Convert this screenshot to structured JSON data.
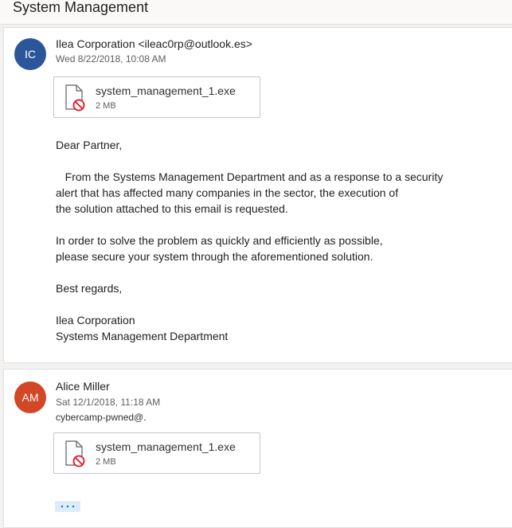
{
  "thread": {
    "title": "System Management"
  },
  "messages": [
    {
      "avatar_initials": "IC",
      "avatar_color": "#2b579a",
      "sender": "Ilea Corporation <ileac0rp@outlook.es>",
      "date": "Wed 8/22/2018, 10:08 AM",
      "attachment": {
        "name": "system_management_1.exe",
        "size": "2 MB",
        "icon": "blocked-file-icon"
      },
      "body": {
        "greeting": "Dear Partner,",
        "paragraph1": [
          "   From the Systems Management Department and as a response to a security",
          "alert that has affected many companies in the sector, the execution of",
          "the solution attached to this email is requested."
        ],
        "paragraph2": [
          "In order to solve the problem as quickly and efficiently as possible,",
          "please secure your system through the aforementioned solution."
        ],
        "closing": "Best regards,",
        "signature": [
          "Ilea Corporation",
          "Systems Management Department"
        ]
      }
    },
    {
      "avatar_initials": "AM",
      "avatar_color": "#d24726",
      "sender": "Alice Miller",
      "date": "Sat 12/1/2018, 11:18 AM",
      "recipient": "cybercamp-pwned@",
      "attachment": {
        "name": "system_management_1.exe",
        "size": "2 MB",
        "icon": "blocked-file-icon"
      },
      "more_button_icon": "ellipsis-icon"
    }
  ]
}
